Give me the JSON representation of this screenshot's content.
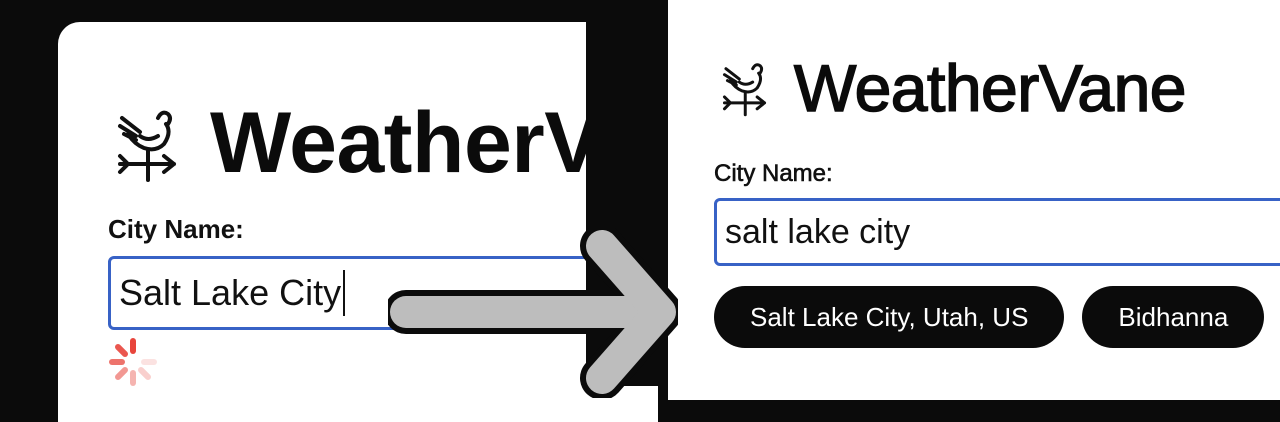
{
  "before": {
    "app_title": "WeatherVane",
    "city_label": "City Name:",
    "city_input_value": "Salt Lake City",
    "loading": true
  },
  "after": {
    "app_title": "WeatherVane",
    "city_label": "City Name:",
    "city_input_value": "salt lake city",
    "suggestions": [
      {
        "label": "Salt Lake City, Utah, US"
      },
      {
        "label": "Bidhanna"
      }
    ]
  },
  "colors": {
    "input_border": "#3862c6",
    "chip_bg": "#0b0b0b",
    "spinner": "#e8453c",
    "arrow": "#bdbdbd"
  },
  "icons": {
    "logo": "weathervane-rooster-icon",
    "transition": "right-arrow-icon",
    "loading": "loading-spinner-icon"
  }
}
